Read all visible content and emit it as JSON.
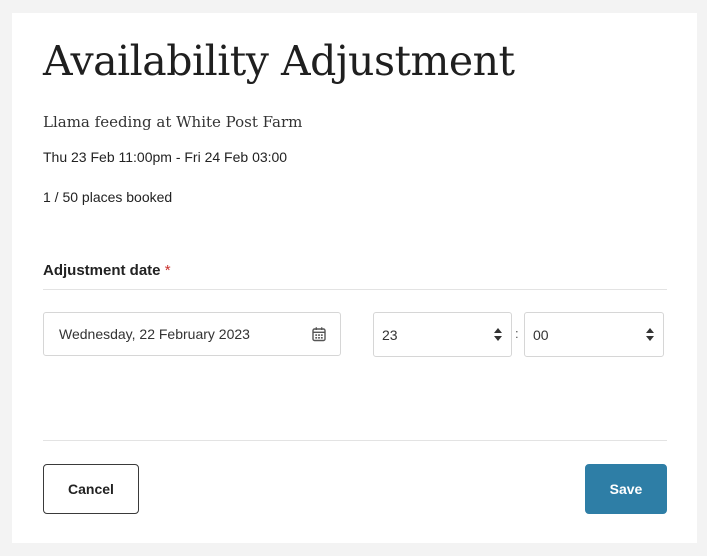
{
  "modal": {
    "title": "Availability Adjustment",
    "event_name": "Llama feeding at White Post Farm",
    "event_time": "Thu 23 Feb 11:00pm - Fri 24 Feb 03:00",
    "places_booked": "1 / 50 places booked"
  },
  "form": {
    "adjustment_date_label": "Adjustment date",
    "required_marker": "*",
    "date_value": "Wednesday, 22 February 2023",
    "hour_value": "23",
    "time_separator": ":",
    "minute_value": "00"
  },
  "actions": {
    "cancel_label": "Cancel",
    "save_label": "Save"
  },
  "colors": {
    "page_background": "#f3f3f3",
    "save_button": "#2e7ea6",
    "required_marker": "#c9302c"
  },
  "icons": {
    "date": "calendar-icon",
    "select": "sort-arrows-icon"
  }
}
